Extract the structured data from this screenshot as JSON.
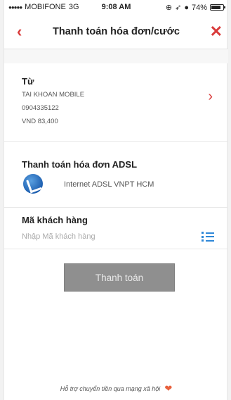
{
  "status_bar": {
    "carrier": "MOBIFONE",
    "network": "3G",
    "time": "9:08 AM",
    "battery": "74%"
  },
  "nav": {
    "back_icon": "‹",
    "title": "Thanh toán hóa đơn/cước",
    "close_icon": "✕"
  },
  "from_account": {
    "label": "Từ",
    "account_name": "TAI KHOAN MOBILE",
    "account_number": "0904335122",
    "balance": "VND 83,400",
    "chevron_icon": "›"
  },
  "bill": {
    "label": "Thanh toán hóa đơn ADSL",
    "service": "Internet ADSL VNPT HCM"
  },
  "customer": {
    "label": "Mã khách hàng",
    "placeholder": "Nhập Mã khách hàng",
    "value": ""
  },
  "pay_button": {
    "label": "Thanh toán"
  },
  "footer": {
    "text": "Hỗ trợ chuyển tiền qua mạng xã hội"
  },
  "colors": {
    "accent": "#d93a3a",
    "button_disabled": "#8f8f8f",
    "list_icon": "#2f88d8"
  }
}
